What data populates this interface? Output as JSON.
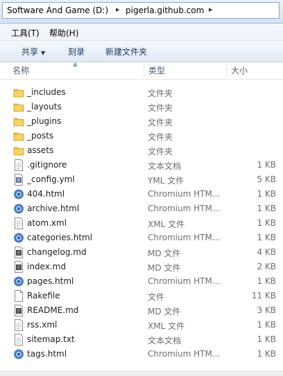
{
  "address": {
    "crumbs": [
      "Software And Game (D:)",
      "pigerla.github.com"
    ],
    "sep": "▸",
    "end_arrow": "▸"
  },
  "menu": {
    "items": [
      "工具(T)",
      "帮助(H)"
    ]
  },
  "toolbar": {
    "share_label": "共享",
    "burn_label": "刻录",
    "new_folder_label": "新建文件夹"
  },
  "columns": {
    "name": "名称",
    "type": "类型",
    "size": "大小"
  },
  "files": [
    {
      "name": "_includes",
      "type": "文件夹",
      "size": "",
      "icon": "folder-icon"
    },
    {
      "name": "_layouts",
      "type": "文件夹",
      "size": "",
      "icon": "folder-icon"
    },
    {
      "name": "_plugins",
      "type": "文件夹",
      "size": "",
      "icon": "folder-icon"
    },
    {
      "name": "_posts",
      "type": "文件夹",
      "size": "",
      "icon": "folder-icon"
    },
    {
      "name": "assets",
      "type": "文件夹",
      "size": "",
      "icon": "folder-icon"
    },
    {
      "name": ".gitignore",
      "type": "文本文档",
      "size": "1 KB",
      "icon": "text-file-icon"
    },
    {
      "name": "_config.yml",
      "type": "YML 文件",
      "size": "5 KB",
      "icon": "yml-file-icon"
    },
    {
      "name": "404.html",
      "type": "Chromium HTM...",
      "size": "1 KB",
      "icon": "chromium-html-icon"
    },
    {
      "name": "archive.html",
      "type": "Chromium HTM...",
      "size": "1 KB",
      "icon": "chromium-html-icon"
    },
    {
      "name": "atom.xml",
      "type": "XML 文件",
      "size": "1 KB",
      "icon": "xml-file-icon"
    },
    {
      "name": "categories.html",
      "type": "Chromium HTM...",
      "size": "1 KB",
      "icon": "chromium-html-icon"
    },
    {
      "name": "changelog.md",
      "type": "MD 文件",
      "size": "4 KB",
      "icon": "md-file-icon"
    },
    {
      "name": "index.md",
      "type": "MD 文件",
      "size": "2 KB",
      "icon": "md-file-icon"
    },
    {
      "name": "pages.html",
      "type": "Chromium HTM...",
      "size": "1 KB",
      "icon": "chromium-html-icon"
    },
    {
      "name": "Rakefile",
      "type": "文件",
      "size": "11 KB",
      "icon": "blank-file-icon"
    },
    {
      "name": "README.md",
      "type": "MD 文件",
      "size": "3 KB",
      "icon": "md-file-icon"
    },
    {
      "name": "rss.xml",
      "type": "XML 文件",
      "size": "1 KB",
      "icon": "xml-file-icon"
    },
    {
      "name": "sitemap.txt",
      "type": "文本文档",
      "size": "1 KB",
      "icon": "text-file-icon"
    },
    {
      "name": "tags.html",
      "type": "Chromium HTM...",
      "size": "1 KB",
      "icon": "chromium-html-icon"
    }
  ],
  "colors": {
    "toolbar_text": "#1e395b",
    "header_text": "#4c607a",
    "secondary_text": "#6d6d6d",
    "folder_yellow": "#f2c94c"
  }
}
